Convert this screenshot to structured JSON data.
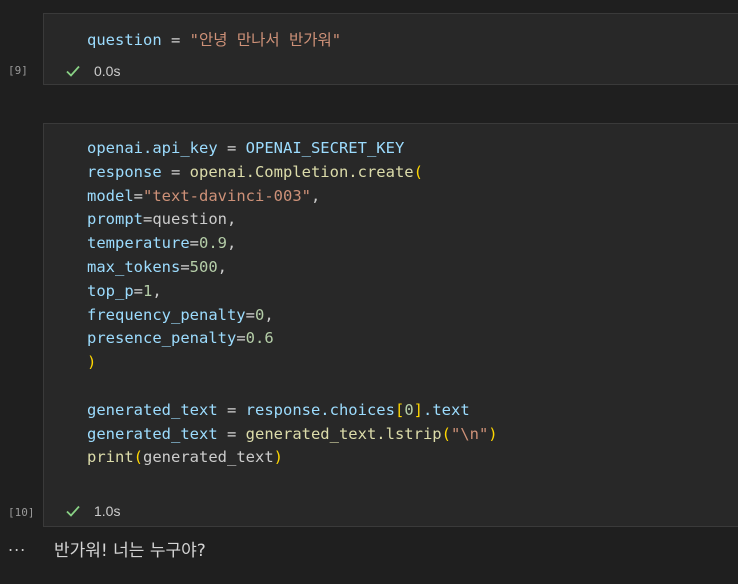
{
  "cells": [
    {
      "exec_count": "[9]",
      "status_time": "0.0s",
      "code": {
        "line1": {
          "var": "question",
          "op": " = ",
          "str": "\"안녕 만나서 반가워\""
        }
      }
    },
    {
      "exec_count": "[10]",
      "status_time": "1.0s",
      "code": {
        "l1": {
          "a": "openai.api_key",
          "b": " = ",
          "c": "OPENAI_SECRET_KEY"
        },
        "l2": {
          "a": "response",
          "b": " = ",
          "c": "openai.Completion.create",
          "d": "("
        },
        "l3": {
          "a": "model",
          "b": "=",
          "c": "\"text-davinci-003\"",
          "d": ","
        },
        "l4": {
          "a": "prompt",
          "b": "=",
          "c": "question",
          "d": ","
        },
        "l5": {
          "a": "temperature",
          "b": "=",
          "c": "0.9",
          "d": ","
        },
        "l6": {
          "a": "max_tokens",
          "b": "=",
          "c": "500",
          "d": ","
        },
        "l7": {
          "a": "top_p",
          "b": "=",
          "c": "1",
          "d": ","
        },
        "l8": {
          "a": "frequency_penalty",
          "b": "=",
          "c": "0",
          "d": ","
        },
        "l9": {
          "a": "presence_penalty",
          "b": "=",
          "c": "0.6"
        },
        "l10": {
          "a": ")"
        },
        "l12": {
          "a": "generated_text",
          "b": " = ",
          "c": "response.choices",
          "d": "[",
          "e": "0",
          "f": "]",
          "g": ".text"
        },
        "l13": {
          "a": "generated_text",
          "b": " = ",
          "c": "generated_text.lstrip",
          "d": "(",
          "e": "\"\\n\"",
          "f": ")"
        },
        "l14": {
          "a": "print",
          "b": "(",
          "c": "generated_text",
          "d": ")"
        }
      }
    }
  ],
  "output": {
    "more_label": "...",
    "text": "반가워! 너는 누구야?"
  },
  "icons": {
    "check": "check-icon",
    "check_color": "#89d185"
  }
}
